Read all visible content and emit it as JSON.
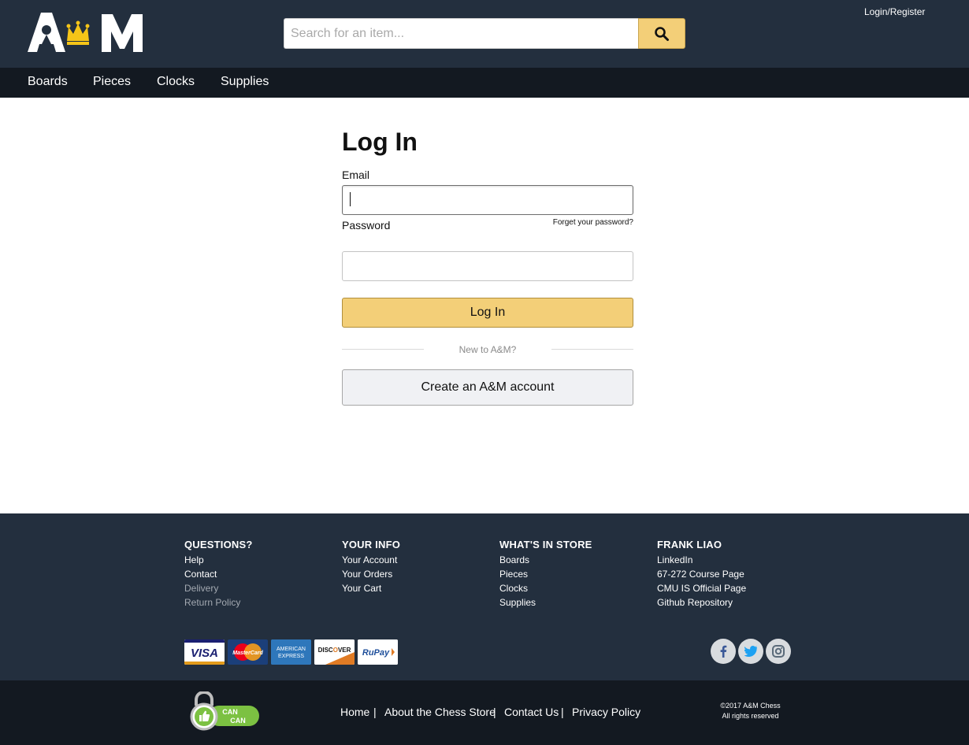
{
  "header": {
    "logo_text": "A&M",
    "search": {
      "placeholder": "Search for an item...",
      "value": ""
    },
    "login_register": "Login/Register"
  },
  "nav": {
    "items": [
      {
        "label": "Boards"
      },
      {
        "label": "Pieces"
      },
      {
        "label": "Clocks"
      },
      {
        "label": "Supplies"
      }
    ]
  },
  "login_form": {
    "title": "Log In",
    "email_label": "Email",
    "email_value": "",
    "password_label": "Password",
    "password_value": "",
    "forgot_password": "Forget your password?",
    "login_button": "Log In",
    "divider_text": "New to A&M?",
    "create_account_button": "Create an A&M account"
  },
  "footer": {
    "columns": [
      {
        "heading": "QUESTIONS?",
        "links": [
          {
            "label": "Help",
            "muted": false
          },
          {
            "label": "Contact",
            "muted": false
          },
          {
            "label": "Delivery",
            "muted": true
          },
          {
            "label": "Return Policy",
            "muted": true
          }
        ]
      },
      {
        "heading": "YOUR INFO",
        "links": [
          {
            "label": "Your Account",
            "muted": false
          },
          {
            "label": "Your Orders",
            "muted": false
          },
          {
            "label": "Your Cart",
            "muted": false
          }
        ]
      },
      {
        "heading": "WHAT'S IN STORE",
        "links": [
          {
            "label": "Boards",
            "muted": false
          },
          {
            "label": "Pieces",
            "muted": false
          },
          {
            "label": "Clocks",
            "muted": false
          },
          {
            "label": "Supplies",
            "muted": false
          }
        ]
      },
      {
        "heading": "FRANK LIAO",
        "links": [
          {
            "label": "LinkedIn",
            "muted": false
          },
          {
            "label": "67-272 Course Page",
            "muted": false
          },
          {
            "label": "CMU IS Official Page",
            "muted": false
          },
          {
            "label": "Github Repository",
            "muted": false
          }
        ]
      }
    ],
    "payment_cards": [
      "VISA",
      "MasterCard",
      "AMERICAN EXPRESS",
      "DISCOVER",
      "RuPay"
    ],
    "social": [
      "facebook-icon",
      "twitter-icon",
      "instagram-icon"
    ],
    "badge_text": [
      "CAN",
      "CAN"
    ],
    "bottom_links": [
      "Home",
      "About the Chess Store",
      "Contact Us",
      "Privacy Policy"
    ],
    "separator": "|",
    "copyright_line1": "©2017 A&M Chess",
    "copyright_line2": "All rights reserved"
  },
  "colors": {
    "header_bg": "#232f3e",
    "nav_bg": "#131921",
    "accent": "#f3cf78",
    "crown": "#f5c518"
  }
}
